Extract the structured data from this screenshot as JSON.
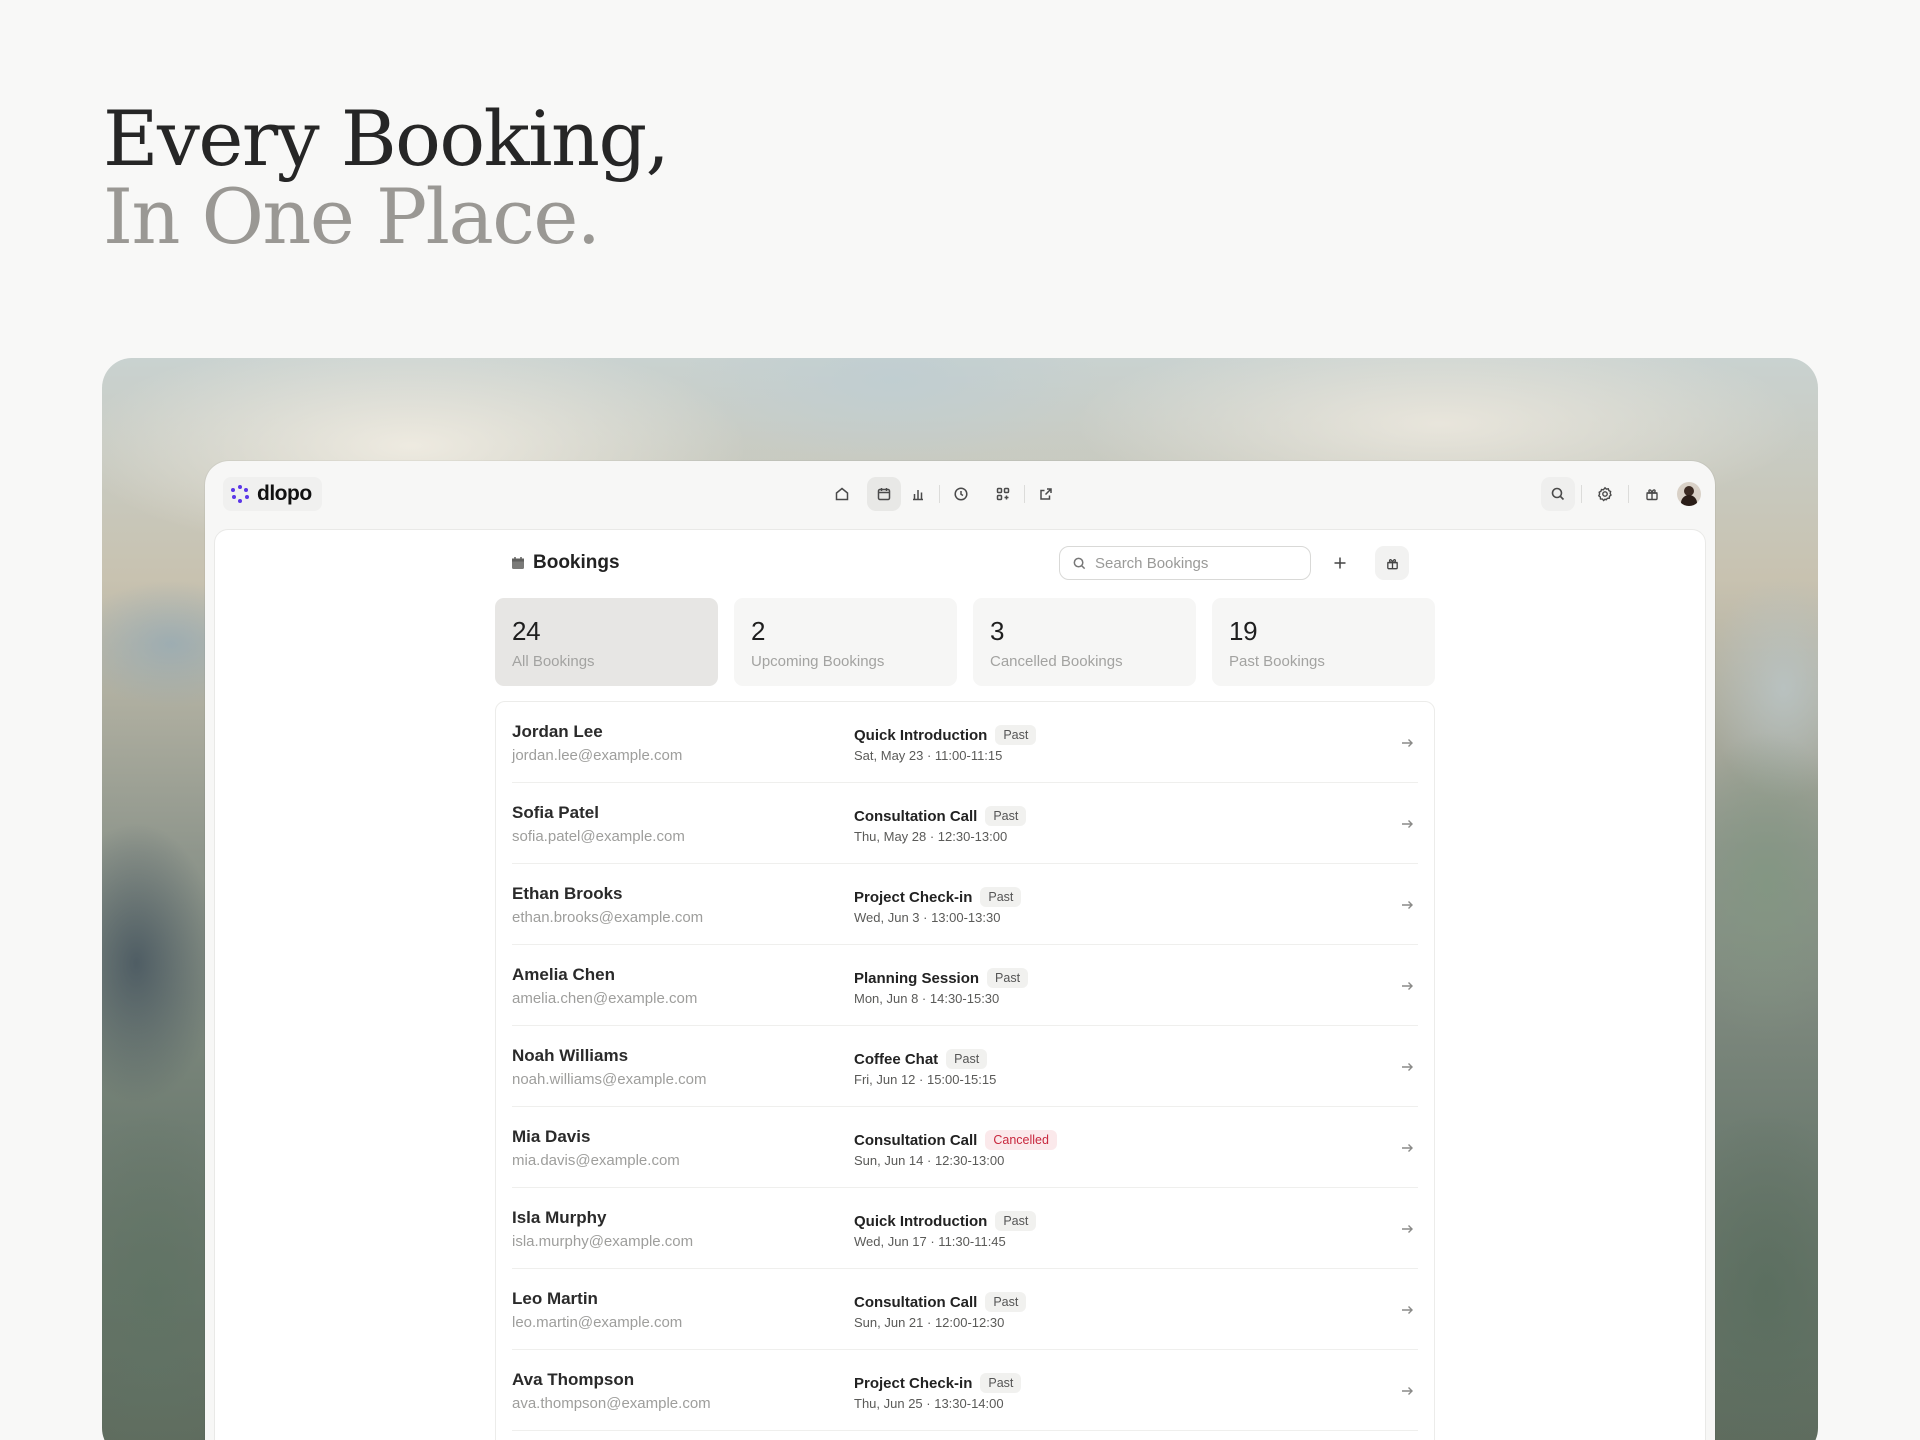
{
  "hero": {
    "line1": "Every Booking,",
    "line2": "In One Place."
  },
  "app": {
    "brand": "dlopo",
    "brand_color": "#5b36e8"
  },
  "nav": {
    "items": [
      {
        "icon": "home-icon"
      },
      {
        "icon": "calendar-icon",
        "active": true
      },
      {
        "icon": "bar-chart-icon"
      },
      {
        "icon": "clock-icon"
      },
      {
        "icon": "apps-icon"
      },
      {
        "icon": "external-link-icon"
      }
    ]
  },
  "page": {
    "title": "Bookings",
    "search_placeholder": "Search Bookings"
  },
  "stats": [
    {
      "value": "24",
      "label": "All Bookings",
      "active": true
    },
    {
      "value": "2",
      "label": "Upcoming Bookings"
    },
    {
      "value": "3",
      "label": "Cancelled Bookings"
    },
    {
      "value": "19",
      "label": "Past Bookings"
    }
  ],
  "bookings": [
    {
      "name": "Jordan Lee",
      "email": "jordan.lee@example.com",
      "event": "Quick Introduction",
      "status": "Past",
      "when": "Sat, May 23 · 11:00-11:15"
    },
    {
      "name": "Sofia Patel",
      "email": "sofia.patel@example.com",
      "event": "Consultation Call",
      "status": "Past",
      "when": "Thu, May 28 · 12:30-13:00"
    },
    {
      "name": "Ethan Brooks",
      "email": "ethan.brooks@example.com",
      "event": "Project Check-in",
      "status": "Past",
      "when": "Wed, Jun 3 · 13:00-13:30"
    },
    {
      "name": "Amelia Chen",
      "email": "amelia.chen@example.com",
      "event": "Planning Session",
      "status": "Past",
      "when": "Mon, Jun 8 · 14:30-15:30"
    },
    {
      "name": "Noah Williams",
      "email": "noah.williams@example.com",
      "event": "Coffee Chat",
      "status": "Past",
      "when": "Fri, Jun 12 · 15:00-15:15"
    },
    {
      "name": "Mia Davis",
      "email": "mia.davis@example.com",
      "event": "Consultation Call",
      "status": "Cancelled",
      "when": "Sun, Jun 14 · 12:30-13:00"
    },
    {
      "name": "Isla Murphy",
      "email": "isla.murphy@example.com",
      "event": "Quick Introduction",
      "status": "Past",
      "when": "Wed, Jun 17 · 11:30-11:45"
    },
    {
      "name": "Leo Martin",
      "email": "leo.martin@example.com",
      "event": "Consultation Call",
      "status": "Past",
      "when": "Sun, Jun 21 · 12:00-12:30"
    },
    {
      "name": "Ava Thompson",
      "email": "ava.thompson@example.com",
      "event": "Project Check-in",
      "status": "Past",
      "when": "Thu, Jun 25 · 13:30-14:00"
    }
  ]
}
